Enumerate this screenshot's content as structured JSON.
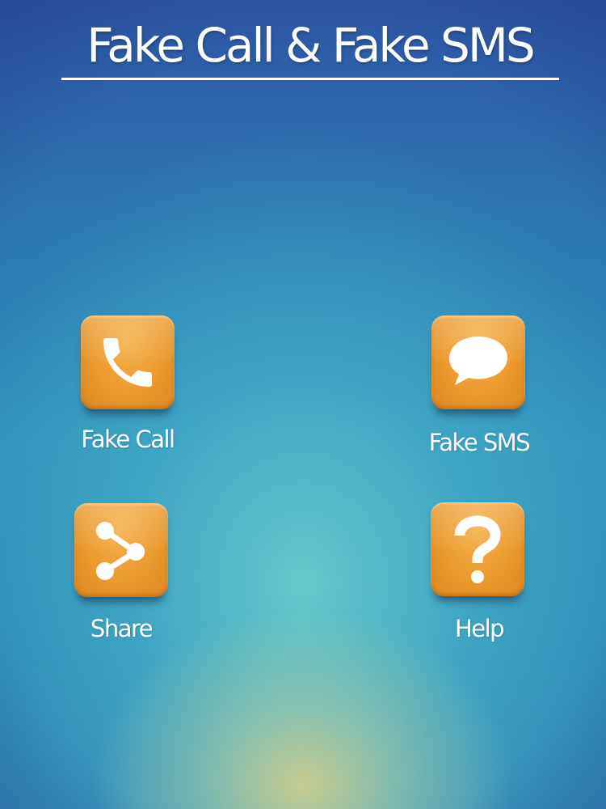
{
  "header": {
    "title": "Fake Call  &  Fake SMS"
  },
  "menu": {
    "items": [
      {
        "label": "Fake Call",
        "icon": "phone-icon"
      },
      {
        "label": "Fake SMS",
        "icon": "speech-bubble-icon"
      },
      {
        "label": "Share",
        "icon": "share-icon"
      },
      {
        "label": "Help",
        "icon": "question-mark-icon"
      }
    ]
  },
  "colors": {
    "tile_orange": "#eb9a2e",
    "background_top": "#2e55a3",
    "background_mid": "#2d8fbb",
    "glow_bottom": "#cdcd8c",
    "text": "#ffffff"
  }
}
